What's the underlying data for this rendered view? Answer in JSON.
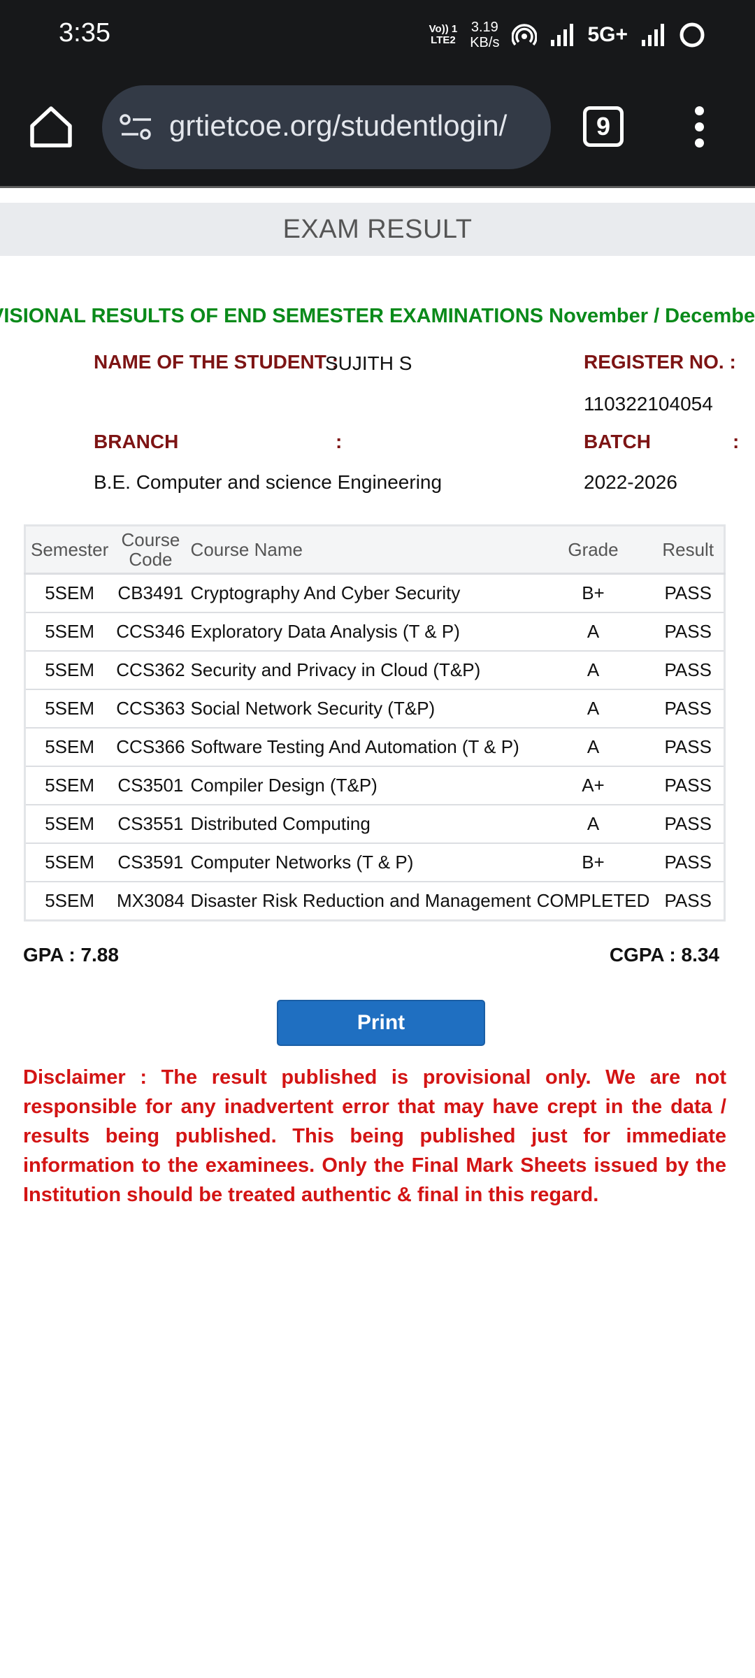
{
  "status_bar": {
    "time": "3:35",
    "volte_line1": "Vo)) 1",
    "volte_line2": "LTE2",
    "speed_value": "3.19",
    "speed_unit": "KB/s",
    "network": "5G+"
  },
  "browser": {
    "url": "grtietcoe.org/studentlogin/",
    "tab_count": "9"
  },
  "page": {
    "title": "EXAM RESULT",
    "headline": "VISIONAL RESULTS OF END SEMESTER EXAMINATIONS November / December -",
    "student_name_label": "NAME OF THE STUDENT :",
    "student_name": "SUJITH S",
    "register_label": "REGISTER NO. :",
    "register_no": "110322104054",
    "branch_label": "BRANCH",
    "branch_colon": ":",
    "branch": "B.E. Computer and science Engineering",
    "batch_label": "BATCH",
    "batch_colon": ":",
    "batch": "2022-2026",
    "table": {
      "headers": {
        "semester": "Semester",
        "course_code": "Course Code",
        "course_name": "Course Name",
        "grade": "Grade",
        "result": "Result"
      },
      "rows": [
        {
          "semester": "5SEM",
          "code": "CB3491",
          "name": "Cryptography And Cyber Security",
          "grade": "B+",
          "result": "PASS"
        },
        {
          "semester": "5SEM",
          "code": "CCS346",
          "name": "Exploratory Data Analysis (T & P)",
          "grade": "A",
          "result": "PASS"
        },
        {
          "semester": "5SEM",
          "code": "CCS362",
          "name": "Security and Privacy in Cloud (T&P)",
          "grade": "A",
          "result": "PASS"
        },
        {
          "semester": "5SEM",
          "code": "CCS363",
          "name": "Social Network Security (T&P)",
          "grade": "A",
          "result": "PASS"
        },
        {
          "semester": "5SEM",
          "code": "CCS366",
          "name": "Software Testing And Automation (T & P)",
          "grade": "A",
          "result": "PASS"
        },
        {
          "semester": "5SEM",
          "code": "CS3501",
          "name": "Compiler Design (T&P)",
          "grade": "A+",
          "result": "PASS"
        },
        {
          "semester": "5SEM",
          "code": "CS3551",
          "name": "Distributed Computing",
          "grade": "A",
          "result": "PASS"
        },
        {
          "semester": "5SEM",
          "code": "CS3591",
          "name": "Computer Networks (T & P)",
          "grade": "B+",
          "result": "PASS"
        },
        {
          "semester": "5SEM",
          "code": "MX3084",
          "name": "Disaster Risk Reduction and Management",
          "grade": "COMPLETED",
          "result": "PASS"
        }
      ]
    },
    "gpa": "GPA : 7.88",
    "cgpa": "CGPA : 8.34",
    "print_label": "Print",
    "disclaimer": "Disclaimer : The result published is provisional only. We are not responsible for any inadvertent error that may have crept in the data / results being published. This being published just for immediate information to the examinees. Only the Final Mark Sheets issued by the Institution should be treated authentic & final in this regard."
  },
  "colors": {
    "label_maroon": "#7d1414",
    "headline_green": "#0a8a1a",
    "disclaimer_red": "#d31414",
    "print_button_blue": "#1f6fc1"
  }
}
